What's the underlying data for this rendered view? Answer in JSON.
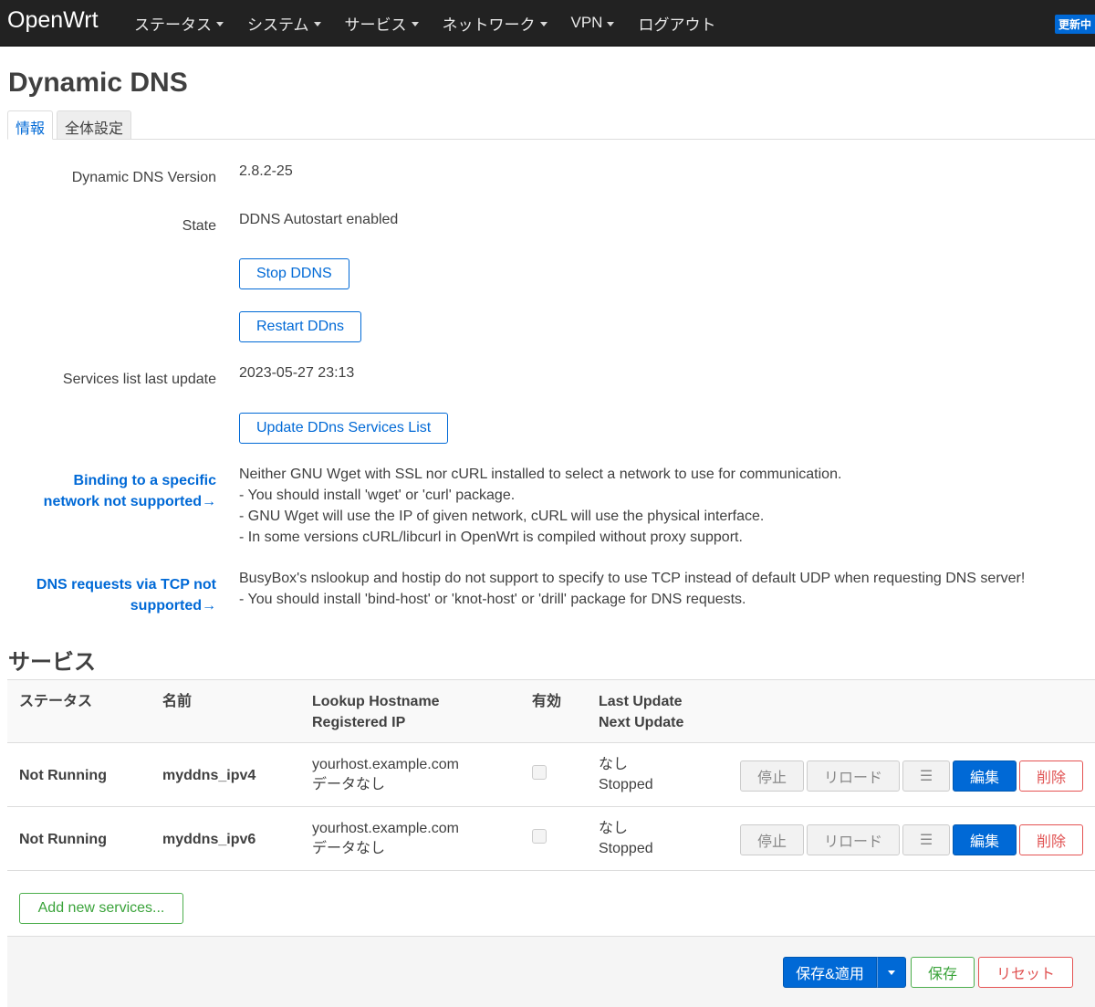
{
  "header": {
    "brand": "OpenWrt",
    "menu": [
      {
        "label": "ステータス"
      },
      {
        "label": "システム"
      },
      {
        "label": "サービス"
      },
      {
        "label": "ネットワーク"
      },
      {
        "label": "VPN"
      },
      {
        "label": "ログアウト"
      }
    ],
    "update_badge": "更新中"
  },
  "page": {
    "title": "Dynamic DNS",
    "tabs": [
      {
        "label": "情報",
        "active": true
      },
      {
        "label": "全体設定",
        "active": false
      }
    ]
  },
  "info": {
    "version_label": "Dynamic DNS Version",
    "version_value": "2.8.2-25",
    "state_label": "State",
    "state_value": "DDNS Autostart enabled",
    "stop_button": "Stop DDNS",
    "restart_button": "Restart DDns",
    "services_update_label": "Services list last update",
    "services_update_value": "2023-05-27 23:13",
    "update_services_button": "Update DDns Services List",
    "binding_label_1": "Binding to a specific",
    "binding_label_2": "network not supported→",
    "binding_desc": [
      "Neither GNU Wget with SSL nor cURL installed to select a network to use for communication.",
      "- You should install 'wget' or 'curl' package.",
      "- GNU Wget will use the IP of given network, cURL will use the physical interface.",
      "- In some versions cURL/libcurl in OpenWrt is compiled without proxy support."
    ],
    "tcp_label_1": "DNS requests via TCP not",
    "tcp_label_2": "supported→",
    "tcp_desc": [
      "BusyBox's nslookup and hostip do not support to specify to use TCP instead of default UDP when requesting DNS server!",
      "- You should install 'bind-host' or 'knot-host' or 'drill' package for DNS requests."
    ]
  },
  "services": {
    "title": "サービス",
    "columns": {
      "status": "ステータス",
      "name": "名前",
      "lookup_1": "Lookup Hostname",
      "lookup_2": "Registered IP",
      "enabled": "有効",
      "update_1": "Last Update",
      "update_2": "Next Update"
    },
    "rows": [
      {
        "status": "Not Running",
        "name": "myddns_ipv4",
        "hostname": "yourhost.example.com",
        "registered_ip": "データなし",
        "enabled": false,
        "last_update": "なし",
        "next_update": "Stopped",
        "btn_stop": "停止",
        "btn_reload": "リロード",
        "btn_log": "☰",
        "btn_edit": "編集",
        "btn_delete": "削除"
      },
      {
        "status": "Not Running",
        "name": "myddns_ipv6",
        "hostname": "yourhost.example.com",
        "registered_ip": "データなし",
        "enabled": false,
        "last_update": "なし",
        "next_update": "Stopped",
        "btn_stop": "停止",
        "btn_reload": "リロード",
        "btn_log": "☰",
        "btn_edit": "編集",
        "btn_delete": "削除"
      }
    ],
    "add_button": "Add new services..."
  },
  "footer": {
    "apply_button": "保存&適用",
    "save_button": "保存",
    "reset_button": "リセット"
  },
  "colors": {
    "header_bg": "#222222",
    "link_blue": "#0069d6",
    "success_green": "#3aa33a",
    "danger_red": "#e05252"
  }
}
